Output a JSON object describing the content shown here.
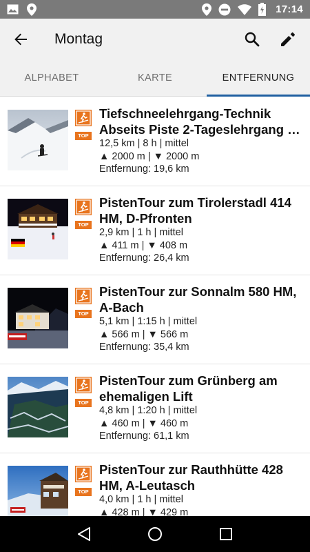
{
  "status_bar": {
    "time": "17:14",
    "left_icons": [
      "image-icon",
      "location-icon"
    ],
    "right_icons": [
      "location-icon",
      "do-not-disturb-icon",
      "wifi-icon",
      "battery-icon"
    ]
  },
  "app_bar": {
    "title": "Montag",
    "back_icon": "arrow-back-icon",
    "actions": [
      "search-icon",
      "edit-icon"
    ]
  },
  "tabs": [
    {
      "label": "ALPHABET",
      "active": false
    },
    {
      "label": "KARTE",
      "active": false
    },
    {
      "label": "ENTFERNUNG",
      "active": true
    }
  ],
  "tours": [
    {
      "title": "Tiefschneelehrgang-Technik Abseits Piste 2-Tageslehrgang …",
      "stats": "12,5 km | 8 h | mittel",
      "elevation": "▲ 2000 m | ▼ 2000 m",
      "distance": "Entfernung: 19,6 km",
      "badge": "TOP"
    },
    {
      "title": "PistenTour zum Tirolerstadl 414 HM, D-Pfronten",
      "stats": "2,9 km | 1 h | mittel",
      "elevation": "▲ 411 m | ▼ 408 m",
      "distance": "Entfernung: 26,4 km",
      "badge": "TOP"
    },
    {
      "title": "PistenTour zur Sonnalm 580 HM, A-Bach",
      "stats": "5,1 km | 1:15 h | mittel",
      "elevation": "▲ 566 m | ▼ 566 m",
      "distance": "Entfernung: 35,4 km",
      "badge": "TOP"
    },
    {
      "title": "PistenTour zum Grünberg am ehemaligen Lift",
      "stats": "4,8 km | 1:20 h | mittel",
      "elevation": "▲ 460 m | ▼ 460 m",
      "distance": "Entfernung: 61,1 km",
      "badge": "TOP"
    },
    {
      "title": "PistenTour zur Rauthhütte 428 HM, A-Leutasch",
      "stats": "4,0 km | 1 h | mittel",
      "elevation": "▲ 428 m | ▼ 429 m",
      "distance": "",
      "badge": "TOP"
    }
  ],
  "nav_bar": [
    "back-triangle-icon",
    "home-circle-icon",
    "recents-square-icon"
  ],
  "colors": {
    "status_bar": "#7a7a7a",
    "app_bar": "#f1f1f1",
    "tab_indicator": "#1f5fa0",
    "badge": "#e8741e"
  }
}
